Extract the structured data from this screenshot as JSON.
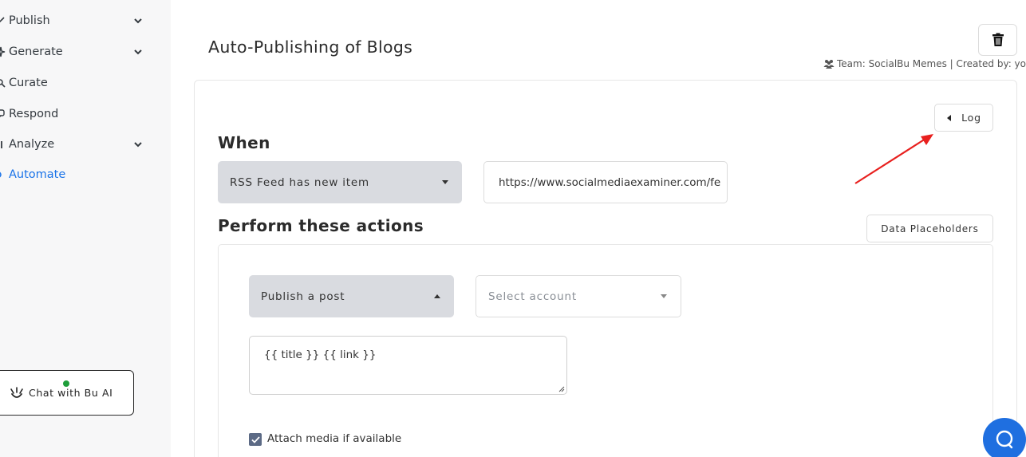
{
  "sidebar": {
    "items": [
      {
        "label": "Publish",
        "icon": "send-icon",
        "has_chevron": true
      },
      {
        "label": "Generate",
        "icon": "sparkle-icon",
        "has_chevron": true
      },
      {
        "label": "Curate",
        "icon": "search-icon",
        "has_chevron": false
      },
      {
        "label": "Respond",
        "icon": "chat-icon",
        "has_chevron": false
      },
      {
        "label": "Analyze",
        "icon": "chart-icon",
        "has_chevron": true
      },
      {
        "label": "Automate",
        "icon": "automation-icon",
        "has_chevron": false,
        "active": true
      }
    ],
    "chat_button_label": "Chat with Bu AI"
  },
  "header": {
    "title": "Auto-Publishing of Blogs",
    "meta": "Team: SocialBu Memes | Created by: you"
  },
  "log_button_label": "Log",
  "when": {
    "heading": "When",
    "trigger_value": "RSS Feed has new item",
    "feed_url": "https://www.socialmediaexaminer.com/fe"
  },
  "actions": {
    "heading": "Perform these actions",
    "data_placeholders_label": "Data Placeholders",
    "action_value": "Publish a post",
    "account_placeholder": "Select account",
    "content_value": "{{ title }} {{ link }}",
    "attach_media_label": "Attach media if available",
    "attach_media_checked": true
  },
  "colors": {
    "accent": "#1a73e8",
    "help_button": "#1f6fe0",
    "annotation_arrow": "#e8201e"
  }
}
